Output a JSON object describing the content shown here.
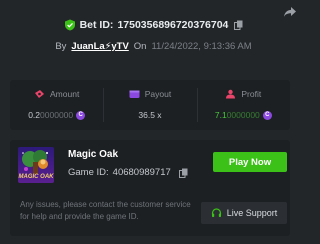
{
  "header": {
    "bet_label": "Bet ID:",
    "bet_id": "1750356896720376704",
    "by_label": "By",
    "user_name": "JuanLa⚡yTV",
    "on_label": "On",
    "date": "11/24/2022, 9:13:36 AM"
  },
  "stats": [
    {
      "label": "Amount",
      "value_main": "0.2",
      "value_dim": "0000000",
      "icon": "money-icon",
      "color": "#e9446a"
    },
    {
      "label": "Payout",
      "value_main": "36.5 x",
      "value_dim": "",
      "icon": "wallet-icon",
      "color": "#8b49e0"
    },
    {
      "label": "Profit",
      "value_main": "7.1",
      "value_dim": "0000000",
      "icon": "profit-icon",
      "color": "#e9446a"
    }
  ],
  "coin_symbol": "C",
  "game": {
    "name": "Magic Oak",
    "id_label": "Game ID:",
    "id": "40680989717",
    "thumbnail_text": "MAGIC OAK",
    "play_label": "Play Now"
  },
  "support": {
    "note": "Any issues, please contact the customer service for help and provide the game ID.",
    "button_label": "Live Support"
  },
  "colors": {
    "accent_green": "#3bc117",
    "background": "#232629",
    "card": "#1d2023"
  }
}
